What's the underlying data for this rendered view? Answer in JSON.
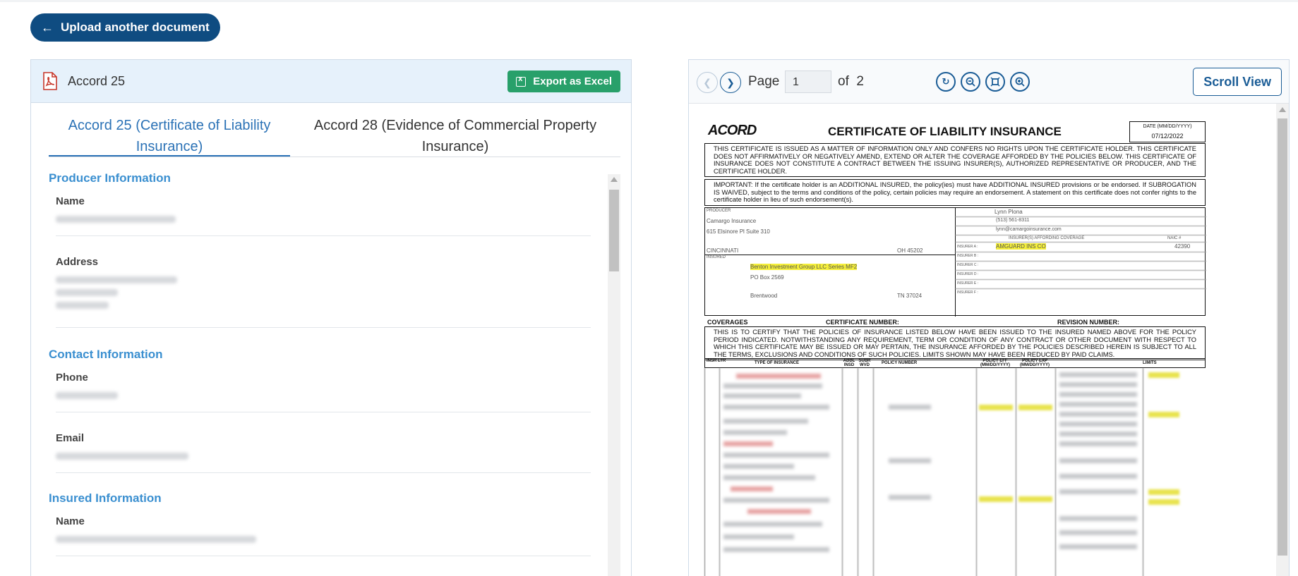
{
  "upload_button": {
    "label": "Upload another document",
    "arrow": "←"
  },
  "left_panel": {
    "title": "Accord 25",
    "export_label": "Export as Excel",
    "tabs": [
      {
        "label": "Accord 25 (Certificate of Liability Insurance)",
        "active": true
      },
      {
        "label": "Accord 28 (Evidence of Commercial Property Insurance)",
        "active": false
      }
    ],
    "sections": {
      "producer": {
        "title": "Producer Information",
        "name_label": "Name",
        "address_label": "Address"
      },
      "contact": {
        "title": "Contact Information",
        "phone_label": "Phone",
        "email_label": "Email"
      },
      "insured": {
        "title": "Insured Information",
        "name_label": "Name"
      }
    }
  },
  "viewer": {
    "page_label": "Page",
    "page_value": "1",
    "of_label": "of",
    "total_pages": "2",
    "scroll_view_label": "Scroll View",
    "icons": [
      "chevron-left-icon",
      "chevron-right-icon",
      "rotate-icon",
      "zoom-out-icon",
      "fit-page-icon",
      "zoom-in-icon"
    ]
  },
  "document": {
    "logo": "ACORD",
    "title": "CERTIFICATE OF LIABILITY INSURANCE",
    "date_label": "DATE (MM/DD/YYYY)",
    "date_value": "07/12/2022",
    "notice1": "THIS CERTIFICATE IS ISSUED AS A MATTER OF INFORMATION ONLY AND CONFERS NO RIGHTS UPON THE CERTIFICATE HOLDER. THIS CERTIFICATE DOES NOT AFFIRMATIVELY OR NEGATIVELY AMEND, EXTEND OR ALTER THE COVERAGE AFFORDED BY THE POLICIES BELOW. THIS CERTIFICATE OF INSURANCE DOES NOT CONSTITUTE A CONTRACT BETWEEN THE ISSUING INSURER(S), AUTHORIZED REPRESENTATIVE OR PRODUCER, AND THE CERTIFICATE HOLDER.",
    "notice2": "IMPORTANT: If the certificate holder is an ADDITIONAL INSURED, the policy(ies) must have ADDITIONAL INSURED provisions or be endorsed. If SUBROGATION IS WAIVED, subject to the terms and conditions of the policy, certain policies may require an endorsement. A statement on this certificate does not confer rights to the certificate holder in lieu of such endorsement(s).",
    "producer_label": "PRODUCER",
    "producer_name": "Camargo Insurance",
    "producer_addr": "615 Elsinore Pl Suite 310",
    "producer_city": "CINCINNATI",
    "producer_state": "OH 45202",
    "contact_name": "Lynn Plona",
    "phone": "(513) 561-8311",
    "email": "lynn@camargoinsurance.com",
    "insurer_header": "INSURER(S) AFFORDING COVERAGE",
    "naic": "NAIC #",
    "insurer_a": "AMGUARD INS CO",
    "insurer_a_naic": "42390",
    "insured_label": "INSURED",
    "insured_name": "Benton Investment Group LLC Series MF2",
    "insured_addr": "PO Box 2569",
    "insured_city": "Brentwood",
    "insured_state": "TN 37024",
    "insurer_letters": [
      "INSURER A :",
      "INSURER B :",
      "INSURER C :",
      "INSURER D :",
      "INSURER E :",
      "INSURER F :"
    ],
    "coverages": "COVERAGES",
    "cert_number": "CERTIFICATE NUMBER:",
    "revision_number": "REVISION NUMBER:",
    "notice3": "THIS IS TO CERTIFY THAT THE POLICIES OF INSURANCE LISTED BELOW HAVE BEEN ISSUED TO THE INSURED NAMED ABOVE FOR THE POLICY PERIOD INDICATED. NOTWITHSTANDING ANY REQUIREMENT, TERM OR CONDITION OF ANY CONTRACT OR OTHER DOCUMENT WITH RESPECT TO WHICH THIS CERTIFICATE MAY BE ISSUED OR MAY PERTAIN, THE INSURANCE AFFORDED BY THE POLICIES DESCRIBED HEREIN IS SUBJECT TO ALL THE TERMS, EXCLUSIONS AND CONDITIONS OF SUCH POLICIES. LIMITS SHOWN MAY HAVE BEEN REDUCED BY PAID CLAIMS.",
    "col_insr": "INSR LTR",
    "col_type": "TYPE OF INSURANCE",
    "col_addl": "ADDL INSD",
    "col_subr": "SUBR WVD",
    "col_policy": "POLICY NUMBER",
    "col_eff": "POLICY EFF (MM/DD/YYYY)",
    "col_exp": "POLICY EXP (MM/DD/YYYY)",
    "col_limits": "LIMITS"
  },
  "colors": {
    "primary": "#0f4c81",
    "accent": "#3a8fd0",
    "export_green": "#28a06a",
    "header_bg": "#e6f1fb"
  }
}
